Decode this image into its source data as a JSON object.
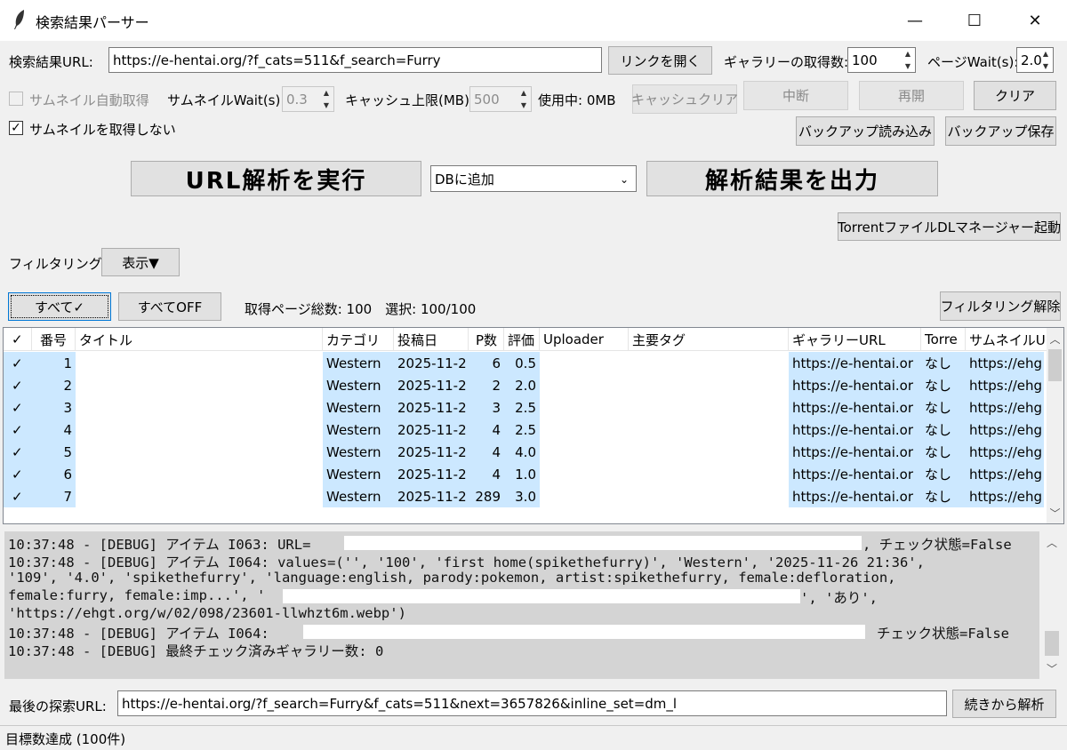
{
  "window": {
    "title": "検索結果パーサー",
    "minimize": "—",
    "maximize": "☐",
    "close": "✕"
  },
  "row1": {
    "url_label": "検索結果URL:",
    "url_value": "https://e-hentai.org/?f_cats=511&f_search=Furry",
    "open_link": "リンクを開く",
    "gallery_count_label": "ギャラリーの取得数:",
    "gallery_count": "100",
    "page_wait_label": "ページWait(s):",
    "page_wait": "2.0"
  },
  "row2": {
    "thumb_auto_label": "サムネイル自動取得",
    "thumb_wait_label": "サムネイルWait(s):",
    "thumb_wait": "0.3",
    "cache_limit_label": "キャッシュ上限(MB):",
    "cache_limit": "500",
    "cache_usage": "使用中: 0MB",
    "cache_clear": "キャッシュクリア",
    "stop": "中断",
    "resume": "再開",
    "clear": "クリア"
  },
  "row3": {
    "no_thumb_label": "サムネイルを取得しない",
    "no_thumb_checked": "✓",
    "backup_load": "バックアップ読み込み",
    "backup_save": "バックアップ保存"
  },
  "actions": {
    "run": "URL解析を実行",
    "mode": "DBに追加",
    "export": "解析結果を出力",
    "torrent": "TorrentファイルDLマネージャー起動"
  },
  "filter": {
    "label": "フィルタリング",
    "toggle": "表示▼",
    "all_on": "すべて✓",
    "all_off": "すべてOFF",
    "summary": "取得ページ総数: 100　選択: 100/100",
    "clear_filter": "フィルタリング解除"
  },
  "table": {
    "columns": [
      "✓",
      "番号",
      "タイトル",
      "カテゴリ",
      "投稿日",
      "P数",
      "評価",
      "Uploader",
      "主要タグ",
      "ギャラリーURL",
      "Torre",
      "サムネイルU"
    ],
    "rows": [
      {
        "check": "✓",
        "num": "1",
        "cat": "Western",
        "date": "2025-11-2",
        "pages": "6",
        "rating": "0.5",
        "url": "https://e-hentai.or",
        "torrent": "なし",
        "thumb": "https://ehg"
      },
      {
        "check": "✓",
        "num": "2",
        "cat": "Western",
        "date": "2025-11-2",
        "pages": "2",
        "rating": "2.0",
        "url": "https://e-hentai.or",
        "torrent": "なし",
        "thumb": "https://ehg"
      },
      {
        "check": "✓",
        "num": "3",
        "cat": "Western",
        "date": "2025-11-2",
        "pages": "3",
        "rating": "2.5",
        "url": "https://e-hentai.or",
        "torrent": "なし",
        "thumb": "https://ehg"
      },
      {
        "check": "✓",
        "num": "4",
        "cat": "Western",
        "date": "2025-11-2",
        "pages": "4",
        "rating": "2.5",
        "url": "https://e-hentai.or",
        "torrent": "なし",
        "thumb": "https://ehg"
      },
      {
        "check": "✓",
        "num": "5",
        "cat": "Western",
        "date": "2025-11-2",
        "pages": "4",
        "rating": "4.0",
        "url": "https://e-hentai.or",
        "torrent": "なし",
        "thumb": "https://ehg"
      },
      {
        "check": "✓",
        "num": "6",
        "cat": "Western",
        "date": "2025-11-2",
        "pages": "4",
        "rating": "1.0",
        "url": "https://e-hentai.or",
        "torrent": "なし",
        "thumb": "https://ehg"
      },
      {
        "check": "✓",
        "num": "7",
        "cat": "Western",
        "date": "2025-11-2",
        "pages": "289",
        "rating": "3.0",
        "url": "https://e-hentai.or",
        "torrent": "なし",
        "thumb": "https://ehg"
      }
    ]
  },
  "log": {
    "lines": [
      "10:37:48 - [DEBUG] アイテム I063: URL=",
      "10:37:48 - [DEBUG] アイテム I064: values=('', '100', 'first home(spikethefurry)', 'Western', '2025-11-26 21:36',",
      "'109', '4.0', 'spikethefurry', 'language:english, parody:pokemon, artist:spikethefurry, female:defloration,",
      "female:furry, female:imp...', '",
      "'https://ehgt.org/w/02/098/23601-llwhzt6m.webp')",
      "10:37:48 - [DEBUG] アイテム I064:",
      "10:37:48 - [DEBUG] 最終チェック済みギャラリー数: 0"
    ],
    "tail_1": ", チェック状態=False",
    "tail_4": "', 'あり',",
    "tail_6": "チェック状態=False"
  },
  "bottom": {
    "last_url_label": "最後の探索URL:",
    "last_url": "https://e-hentai.org/?f_search=Furry&f_cats=511&next=3657826&inline_set=dm_l",
    "continue": "続きから解析"
  },
  "status": "目標数達成 (100件)"
}
